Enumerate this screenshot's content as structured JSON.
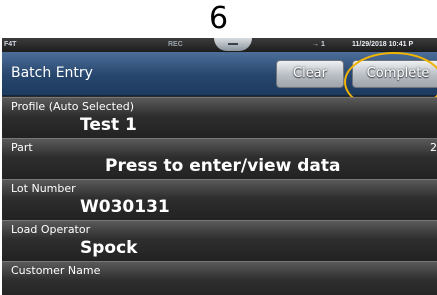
{
  "step_label": "6",
  "status_bar": {
    "model": "F4T",
    "rec": "REC",
    "usb": "1",
    "datetime": "11/29/2018 10:41 P"
  },
  "header": {
    "title": "Batch Entry",
    "clear_label": "Clear",
    "complete_label": "Complete"
  },
  "fields": [
    {
      "label": "Profile (Auto Selected)",
      "value": "Test 1"
    },
    {
      "label": "Part",
      "value": "Press to enter/view data",
      "extra": "2"
    },
    {
      "label": "Lot Number",
      "value": "W030131"
    },
    {
      "label": "Load Operator",
      "value": "Spock"
    },
    {
      "label": "Customer Name",
      "value": ""
    }
  ]
}
